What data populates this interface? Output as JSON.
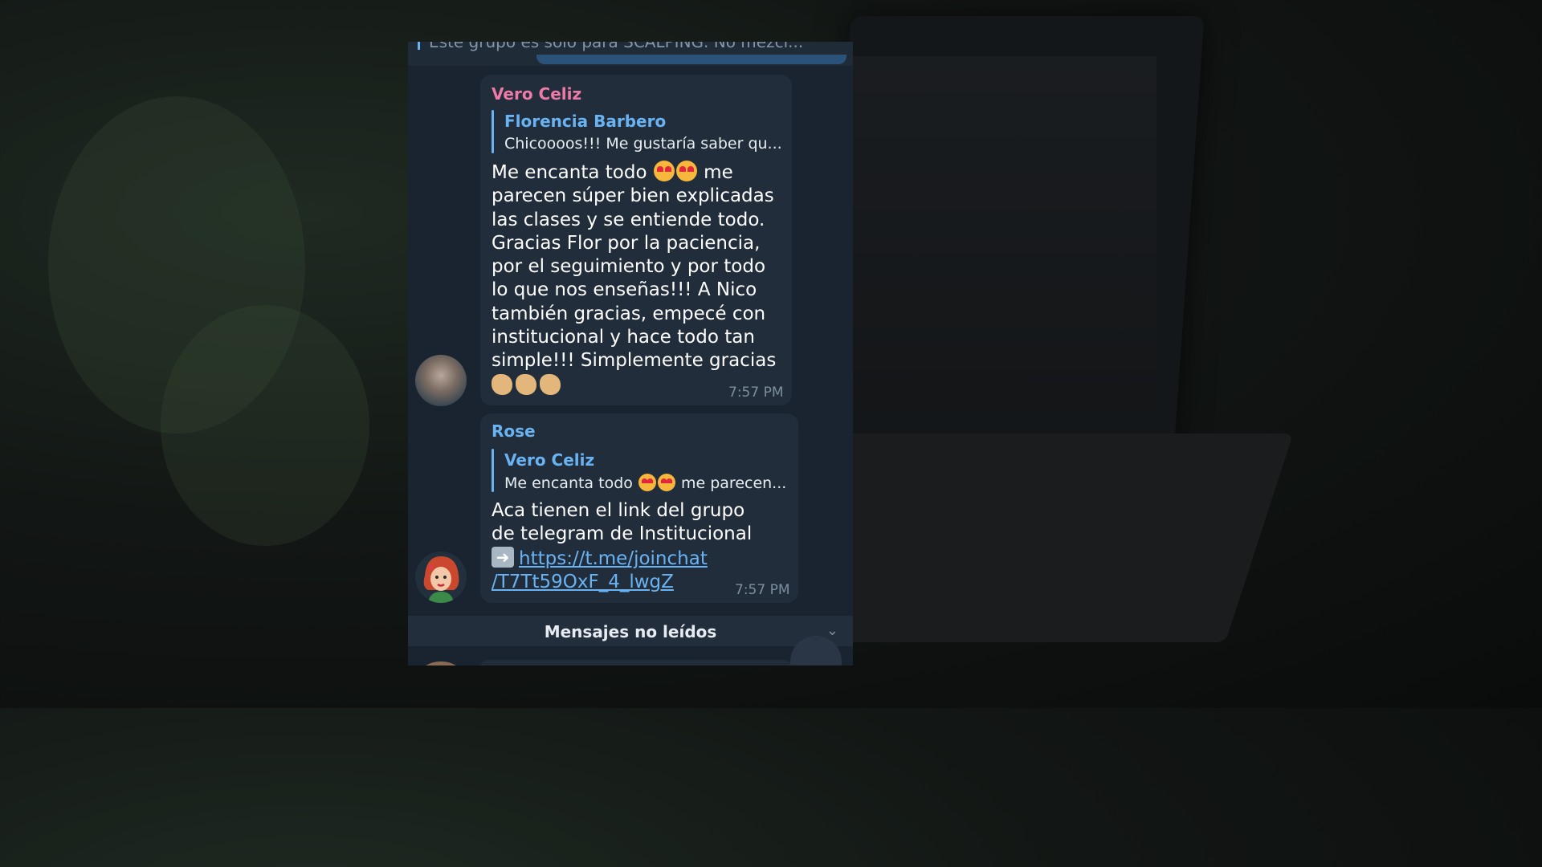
{
  "pinned": {
    "text": "Este grupo es solo para SCALPING. No mezcl..."
  },
  "messages": [
    {
      "sender": "Vero Celiz",
      "reply_to": {
        "name": "Florencia Barbero",
        "text": "Chicoooos!!! Me gustaría saber qu..."
      },
      "lines": [
        "Me encanta todo",
        "me",
        "parecen súper bien explicadas",
        "las clases y se entiende todo.",
        "Gracias Flor por la paciencia,",
        "por el seguimiento y por todo",
        "lo que nos enseñas!!! A Nico",
        "también gracias, empecé con",
        "institucional y hace todo tan",
        "simple!!! Simplemente gracias"
      ],
      "time": "7:57 PM"
    },
    {
      "sender": "Rose",
      "reply_to": {
        "name": "Vero Celiz",
        "text_before": "Me encanta todo",
        "text_after": "me parecen..."
      },
      "lines": [
        "Aca tienen el link del grupo",
        "de telegram de Institucional"
      ],
      "link_line1": "https://t.me/joinchat",
      "link_line2": "/T7Tt59OxF_4_lwgZ",
      "time": "7:57 PM"
    }
  ],
  "unread_banner": {
    "label": "Mensajes no leídos"
  },
  "icons": {
    "unread_chevron": "chevron-down-icon",
    "scroll_down": "chevron-down-icon",
    "arrow": "right-arrow-emoji"
  },
  "colors": {
    "chat_bg": "#1a2430",
    "bubble": "#212d3b",
    "sender_vero": "#ee7aa7",
    "sender_rose": "#6ab3f3",
    "link": "#6ab3f3"
  }
}
